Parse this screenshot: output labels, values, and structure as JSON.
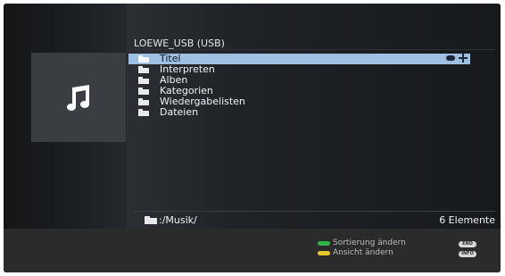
{
  "browser": {
    "source_title": "LOEWE_USB (USB)",
    "items": [
      {
        "label": "Titel",
        "selected": true
      },
      {
        "label": "Interpreten",
        "selected": false
      },
      {
        "label": "Alben",
        "selected": false
      },
      {
        "label": "Kategorien",
        "selected": false
      },
      {
        "label": "Wiedergabelisten",
        "selected": false
      },
      {
        "label": "Dateien",
        "selected": false
      }
    ],
    "path": ":/Musik/",
    "item_count": "6 Elemente"
  },
  "footer": {
    "hint_sort": "Sortierung ändern",
    "hint_view": "Ansicht ändern",
    "key_end": "END",
    "key_info": "INFO"
  },
  "colors": {
    "selection": "#9fbfe3",
    "green_key": "#2fb34a",
    "yellow_key": "#e6c82a"
  },
  "icons": {
    "media_type": "music-note-icon",
    "folder": "folder-icon",
    "ok": "ok-icon",
    "navigation": "nav-cross-icon"
  }
}
